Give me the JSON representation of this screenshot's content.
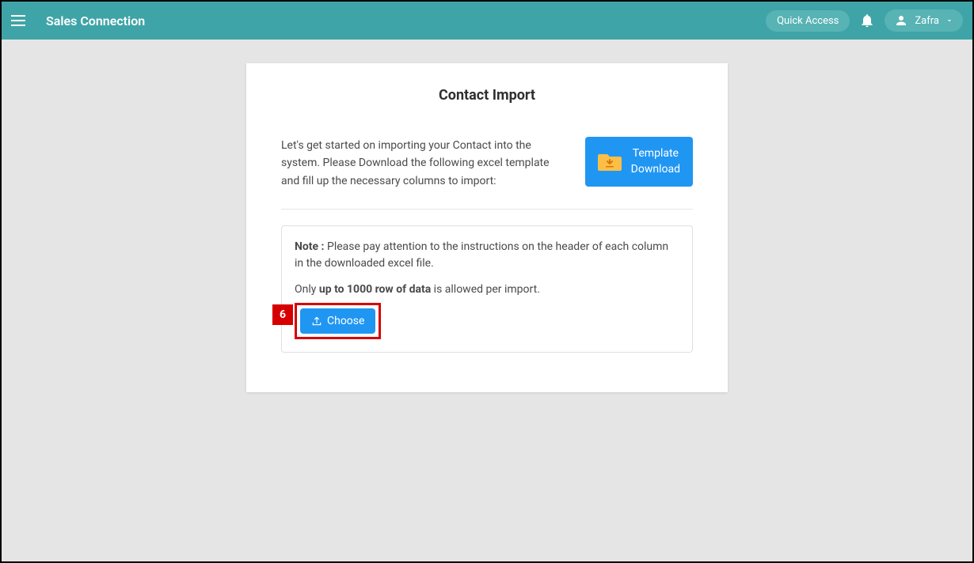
{
  "header": {
    "app_title": "Sales Connection",
    "quick_access_label": "Quick Access",
    "user_name": "Zafra"
  },
  "card": {
    "title": "Contact Import",
    "intro_text": "Let's get started on importing your Contact into the system. Please Download the following excel template and fill up the necessary columns to import:",
    "template_button_line1": "Template",
    "template_button_line2": "Download",
    "note_label": "Note :",
    "note_text": " Please pay attention to the instructions on the header of each column in the downloaded excel file.",
    "only_prefix": "Only ",
    "row_limit_bold": "up to 1000 row of data",
    "only_suffix": " is allowed per import.",
    "choose_label": "Choose",
    "callout_number": "6"
  }
}
